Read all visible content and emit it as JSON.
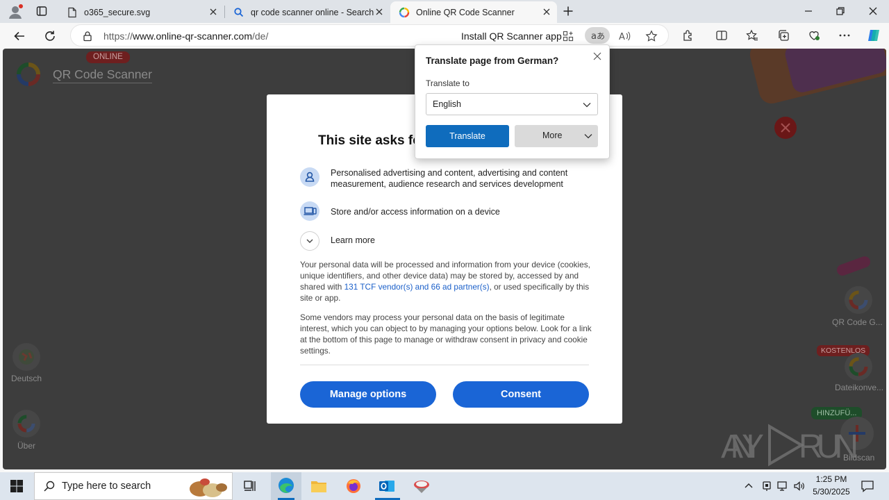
{
  "browser": {
    "tabs": [
      {
        "title": "o365_secure.svg"
      },
      {
        "title": "qr code scanner online - Search"
      },
      {
        "title": "Online QR Code Scanner"
      }
    ],
    "url_scheme": "https://",
    "url_host": "www.online-qr-scanner.com",
    "url_path": "/de/",
    "install_app": "Install QR Scanner app"
  },
  "site": {
    "badge_online": "ONLINE",
    "logo_text": "QR Code Scanner",
    "left_items": [
      {
        "label": "Deutsch"
      },
      {
        "label": "Über"
      }
    ],
    "right_items": [
      {
        "label": "QR Code G..."
      },
      {
        "label": "Dateikonve..."
      },
      {
        "label": "Bildscan"
      }
    ],
    "badge_kostenlos": "KOSTENLOS",
    "badge_hinzufu": "HINZUFÜ...",
    "watermark": "ANY RUN"
  },
  "consent": {
    "title": "This site asks fo",
    "items": [
      {
        "text": "Personalised advertising and content, advertising and content measurement, audience research and services development"
      },
      {
        "text": "Store and/or access information on a device"
      }
    ],
    "learn_more": "Learn more",
    "para1_a": "Your personal data will be processed and information from your device (cookies, unique identifiers, and other device data) may be stored by, accessed by and shared with ",
    "para1_link": "131 TCF vendor(s) and 66 ad partner(s)",
    "para1_b": ", or used specifically by this site or app.",
    "para2": "Some vendors may process your personal data on the basis of legitimate interest, which you can object to by managing your options below. Look for a link at the bottom of this page to manage or withdraw consent in privacy and cookie settings.",
    "manage_label": "Manage options",
    "consent_label": "Consent"
  },
  "translate_popup": {
    "title": "Translate page from German?",
    "translate_to_label": "Translate to",
    "selected_language": "English",
    "translate_button": "Translate",
    "more_button": "More"
  },
  "taskbar": {
    "search_placeholder": "Type here to search",
    "time": "1:25 PM",
    "date": "5/30/2025"
  },
  "colors": {
    "accent_blue": "#1a65d6",
    "translate_blue": "#0f6cbd",
    "page_overlay": "#3d3d3d"
  }
}
